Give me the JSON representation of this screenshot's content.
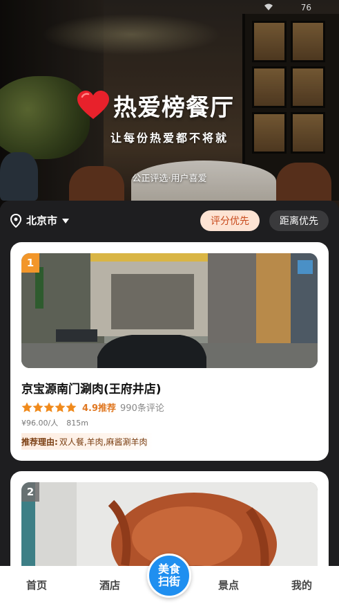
{
  "status_bar": {
    "battery_text": "76"
  },
  "hero": {
    "title": "热爱榜餐厅",
    "subtitle": "让每份热爱都不将就",
    "tagline": "公正评选·用户喜爱"
  },
  "filter": {
    "city": "北京市",
    "sort_options": [
      {
        "label": "评分优先",
        "active": true
      },
      {
        "label": "距离优先",
        "active": false
      }
    ]
  },
  "restaurants": [
    {
      "rank": "1",
      "name": "京宝源南门涮肉(王府井店)",
      "stars": 5,
      "rating_label": "4.9推荐",
      "review_count": "990条评论",
      "price": "¥96.00/人",
      "distance": "815m",
      "reason_label": "推荐理由:",
      "reason_text": "双人餐,羊肉,麻酱涮羊肉"
    },
    {
      "rank": "2"
    }
  ],
  "tabbar": {
    "home": "首页",
    "hotel": "酒店",
    "scan_line1": "美食",
    "scan_line2": "扫街",
    "spot": "景点",
    "mine": "我的"
  },
  "colors": {
    "accent_orange": "#e07822",
    "chip_active_bg": "#fde3d3",
    "scan_blue": "#1f8ff0"
  }
}
